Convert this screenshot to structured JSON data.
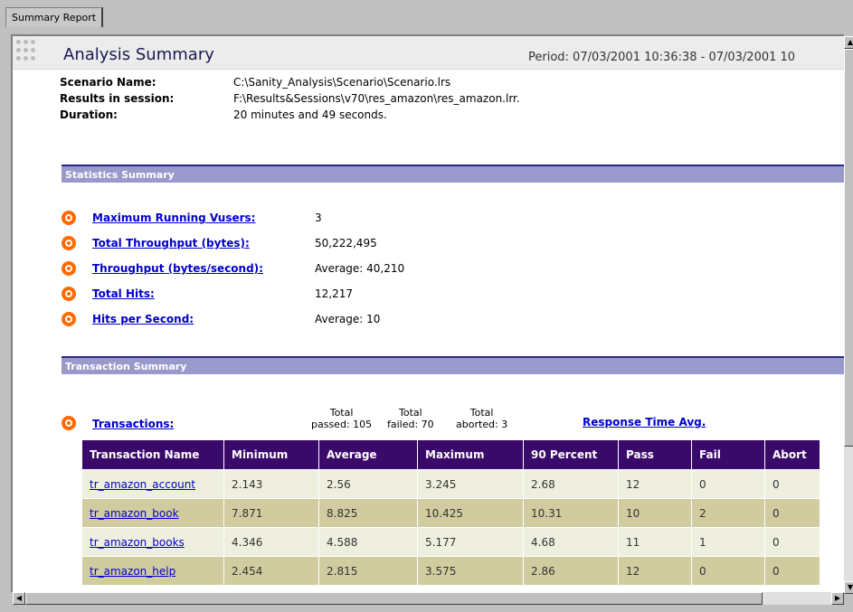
{
  "tab": {
    "label": "Summary Report"
  },
  "header": {
    "title": "Analysis Summary",
    "period": "Period: 07/03/2001 10:36:38 - 07/03/2001 10"
  },
  "info": {
    "scenario_label": "Scenario Name:",
    "scenario_value": "C:\\Sanity_Analysis\\Scenario\\Scenario.lrs",
    "results_label": "Results in session:",
    "results_value": "F:\\Results&Sessions\\v70\\res_amazon\\res_amazon.lrr.",
    "duration_label": "Duration:",
    "duration_value": "20 minutes and 49 seconds."
  },
  "statistics": {
    "section_title": "Statistics Summary",
    "rows": [
      {
        "label": "Maximum Running Vusers:",
        "value": "3"
      },
      {
        "label": "Total Throughput (bytes):",
        "value": "50,222,495"
      },
      {
        "label": "Throughput (bytes/second):",
        "value": "Average: 40,210"
      },
      {
        "label": "Total Hits:",
        "value": "12,217"
      },
      {
        "label": "Hits per Second:",
        "value": "Average: 10"
      }
    ]
  },
  "transactions": {
    "section_title": "Transaction Summary",
    "link_label": "Transactions:",
    "total_word": "Total",
    "passed_text": "passed: 105",
    "failed_text": "failed: 70",
    "aborted_text": "aborted: 3",
    "rta_label": "Response Time Avg.",
    "columns": [
      "Transaction Name",
      "Minimum",
      "Average",
      "Maximum",
      "90 Percent",
      "Pass",
      "Fail",
      "Abort"
    ],
    "rows": [
      [
        "tr_amazon_account",
        "2.143",
        "2.56",
        "3.245",
        "2.68",
        "12",
        "0",
        "0"
      ],
      [
        "tr_amazon_book",
        "7.871",
        "8.825",
        "10.425",
        "10.31",
        "10",
        "2",
        "0"
      ],
      [
        "tr_amazon_books",
        "4.346",
        "4.588",
        "5.177",
        "4.68",
        "11",
        "1",
        "0"
      ],
      [
        "tr_amazon_help",
        "2.454",
        "2.815",
        "3.575",
        "2.86",
        "12",
        "0",
        "0"
      ]
    ]
  },
  "colors": {
    "section_bg": "#9999cc",
    "table_header_bg": "#3a0a6a",
    "bullet": "#ff6a00",
    "link": "#0000cc"
  }
}
